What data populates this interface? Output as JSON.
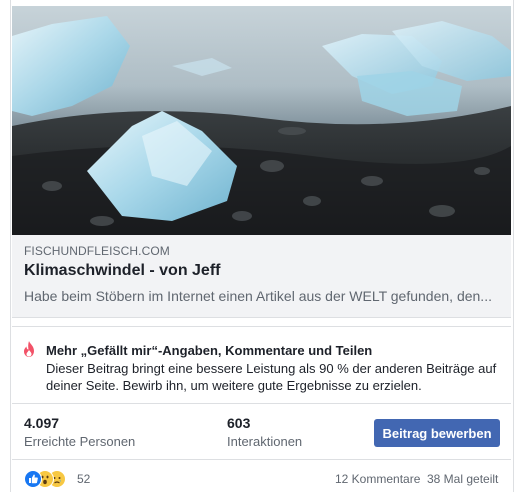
{
  "link_preview": {
    "domain": "FISCHUNDFLEISCH.COM",
    "title": "Klimaschwindel - von Jeff",
    "description": "Habe beim Stöbern im Internet einen Artikel aus der WELT gefunden, den..."
  },
  "tip": {
    "icon": "flame-icon",
    "title": "Mehr „Gefällt mir“-Angaben, Kommentare und Teilen",
    "text": "Dieser Beitrag bringt eine bessere Leistung als 90 % der anderen Beiträge auf deiner Seite. Bewirb ihn, um weitere gute Ergebnisse zu erzielen."
  },
  "stats": {
    "reach_value": "4.097",
    "reach_label": "Erreichte Personen",
    "interactions_value": "603",
    "interactions_label": "Interaktionen"
  },
  "boost_button_label": "Beitrag bewerben",
  "footer": {
    "reactions": [
      "like-icon",
      "wow-icon",
      "sad-icon"
    ],
    "reaction_count": "52",
    "comments": "12 Kommentare",
    "shares": "38 Mal geteilt"
  },
  "colors": {
    "accent": "#4267b2",
    "tip_flame": "#f25268"
  }
}
